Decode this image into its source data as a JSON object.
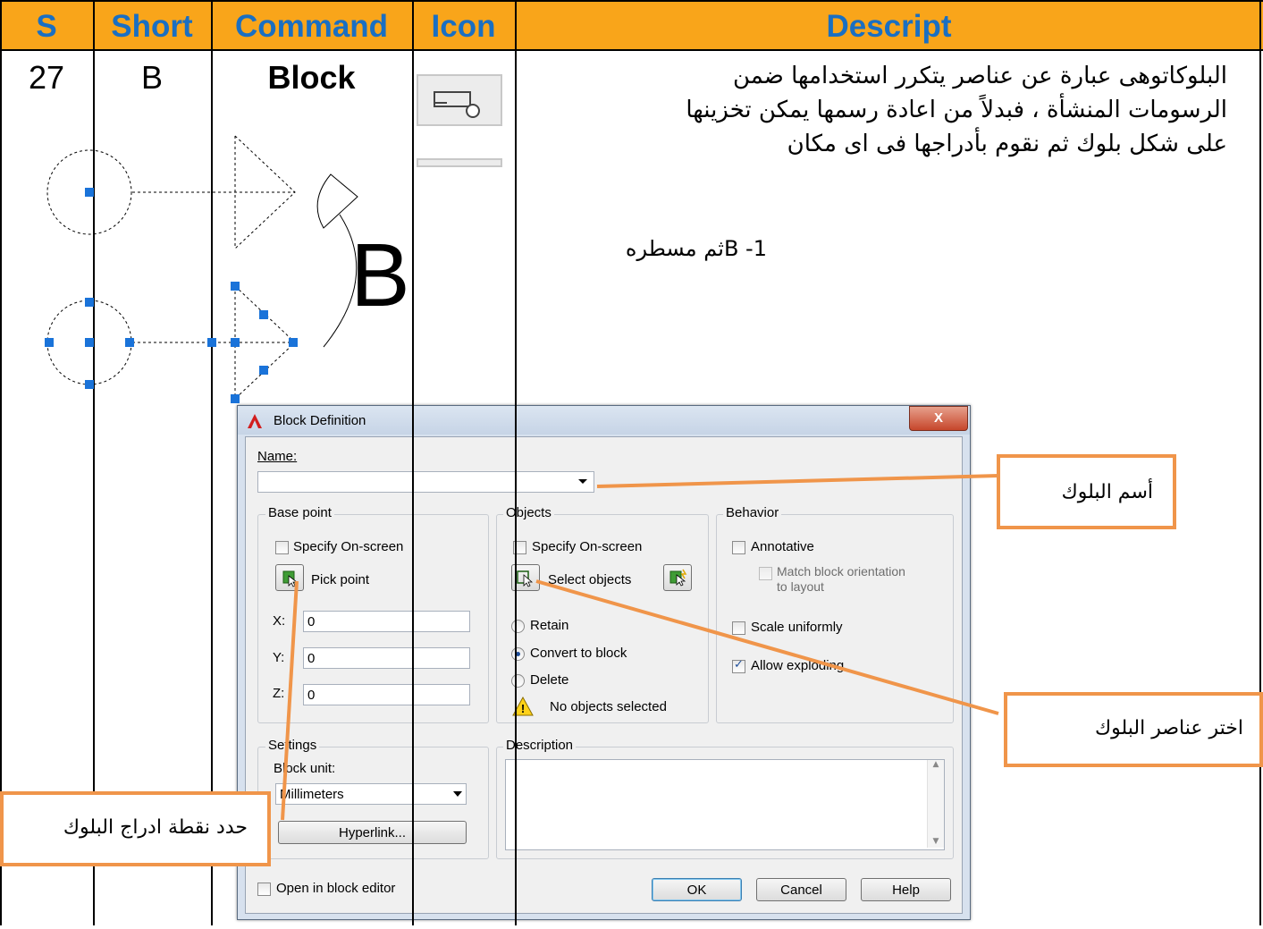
{
  "table": {
    "headers": {
      "s": "S",
      "short": "Short",
      "command": "Command",
      "icon": "Icon",
      "descript": "Descript"
    },
    "row": {
      "s": "27",
      "short": "B",
      "command": "Block",
      "description_lines": [
        "البلوكاتوهى عبارة عن عناصر يتكرر استخدامها ضمن",
        "الرسومات المنشأة ، فبدلاً من اعادة رسمها يمكن تخزينها",
        "على شكل بلوك ثم نقوم بأدراجها فى اى مكان"
      ],
      "step": "1- Bثم مسطره"
    }
  },
  "illustration": {
    "big_letter": "B"
  },
  "dialog": {
    "title": "Block Definition",
    "close": "X",
    "name_label": "Name:",
    "name_value": "",
    "base_point": {
      "title": "Base point",
      "specify_on_screen": "Specify On-screen",
      "pick_point": "Pick point",
      "x_label": "X:",
      "x_value": "0",
      "y_label": "Y:",
      "y_value": "0",
      "z_label": "Z:",
      "z_value": "0"
    },
    "objects": {
      "title": "Objects",
      "specify_on_screen": "Specify On-screen",
      "select_objects": "Select objects",
      "retain": "Retain",
      "convert_to_block": "Convert to block",
      "delete": "Delete",
      "status": "No objects selected"
    },
    "behavior": {
      "title": "Behavior",
      "annotative": "Annotative",
      "match_block_orientation_1": "Match block orientation",
      "match_block_orientation_2": "to layout",
      "scale_uniformly": "Scale uniformly",
      "allow_exploding": "Allow exploding",
      "allow_exploding_checked": true
    },
    "settings": {
      "title": "Settings",
      "block_unit_label": "Block unit:",
      "block_unit_value": "Millimeters",
      "hyperlink": "Hyperlink..."
    },
    "description_title": "Description",
    "open_in_block_editor": "Open in block editor",
    "ok": "OK",
    "cancel": "Cancel",
    "help": "Help"
  },
  "callouts": {
    "block_name": "أسم البلوك",
    "select_elements": "اختر عناصر البلوك",
    "insertion_point": "حدد نقطة ادراج البلوك"
  },
  "colors": {
    "header_bg": "#f9a51a",
    "header_text": "#1a6fc2",
    "callout_border": "#f0954a",
    "grip": "#1a73d9"
  }
}
